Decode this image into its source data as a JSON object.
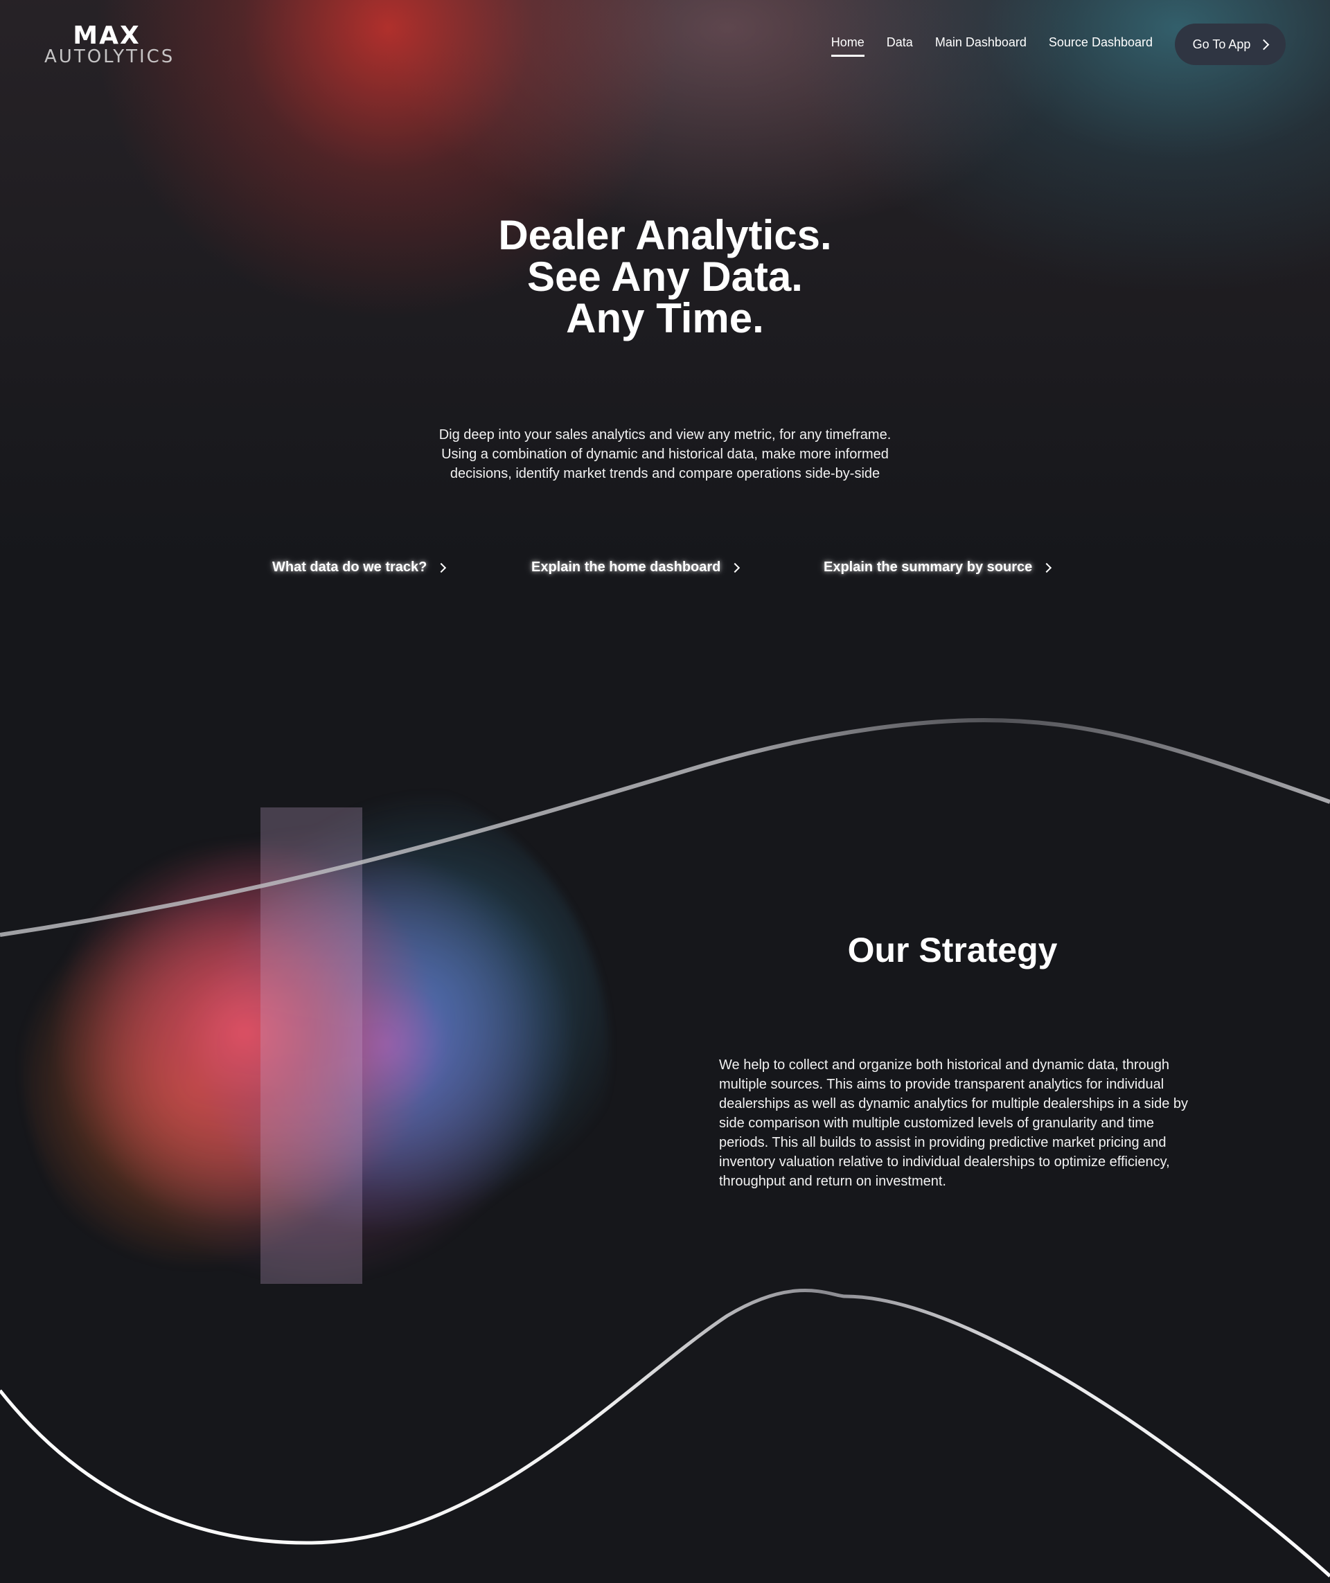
{
  "brand": {
    "name_top": "MAX",
    "name_bottom": "AUTOLYTICS"
  },
  "nav": {
    "items": [
      {
        "label": "Home",
        "active": true
      },
      {
        "label": "Data",
        "active": false
      },
      {
        "label": "Main Dashboard",
        "active": false
      },
      {
        "label": "Source Dashboard",
        "active": false
      }
    ],
    "cta_label": "Go To App"
  },
  "hero": {
    "title": "Dealer Analytics. See Any Data. Any Time.",
    "subtitle": "Dig deep into your sales analytics and view any metric, for any timeframe. Using a combination of dynamic and historical data, make more informed decisions, identify market trends and compare operations side-by-side",
    "links": [
      {
        "label": "What data do we track?"
      },
      {
        "label": "Explain the home dashboard"
      },
      {
        "label": "Explain the summary by source"
      }
    ]
  },
  "strategy": {
    "title": "Our Strategy",
    "body": "We help to collect and organize both historical and dynamic data, through multiple sources. This aims to provide transparent analytics for individual dealerships as well as dynamic analytics for multiple dealerships in a side by side comparison with multiple customized levels of granularity and time periods. This all builds to assist in providing predictive market pricing and inventory valuation relative to individual dealerships to optimize efficiency, throughput and return on investment."
  },
  "colors": {
    "background": "#16171b",
    "cta_background": "#2f3542",
    "glow_red": "#c8322d",
    "glow_teal": "#377382"
  }
}
